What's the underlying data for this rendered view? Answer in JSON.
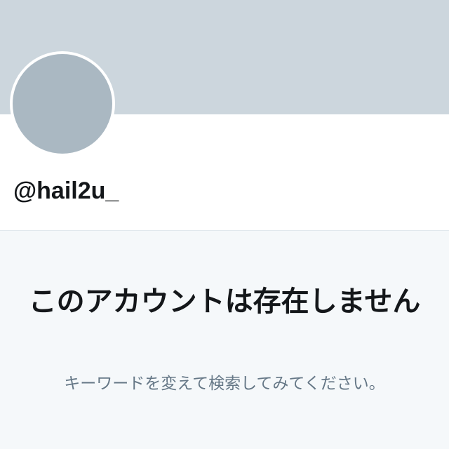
{
  "profile": {
    "handle": "@hail2u_"
  },
  "empty_state": {
    "title": "このアカウントは存在しません",
    "subtitle": "キーワードを変えて検索してみてください。"
  },
  "colors": {
    "banner": "#ccd6dd",
    "avatar": "#aab8c2",
    "empty_background": "#f5f8fa",
    "title_text": "#14171a",
    "subtitle_text": "#657786"
  }
}
